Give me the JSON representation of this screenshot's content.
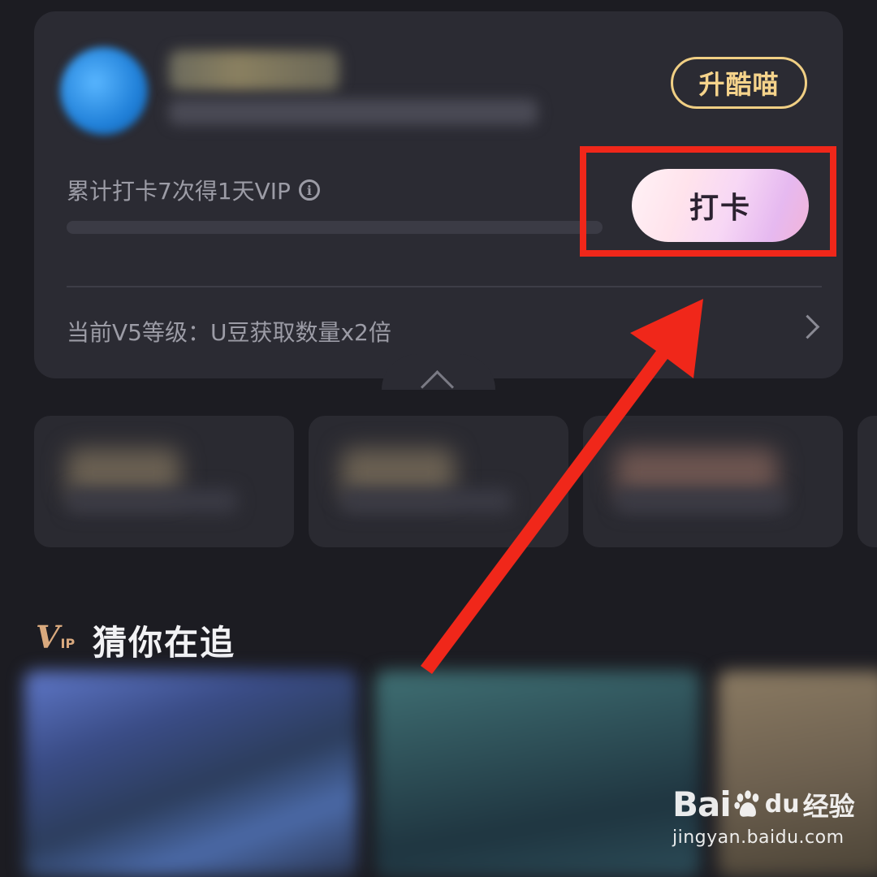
{
  "member_card": {
    "upgrade_label": "升酷喵",
    "checkin_info": "累计打卡7次得1天VIP",
    "info_icon": "info-icon",
    "checkin_progress": 0,
    "checkin_label": "打卡",
    "level_text": "当前V5等级：U豆获取数量x2倍",
    "chevron_icon": "chevron-right-icon"
  },
  "section": {
    "vip_badge_v": "V",
    "vip_badge_ip": "IP",
    "title": "猜你在追"
  },
  "watermark": {
    "brand": "Bai",
    "brand_du": "du",
    "product": "经验",
    "url": "jingyan.baidu.com"
  },
  "colors": {
    "background": "#1c1c22",
    "card": "#2b2b33",
    "upgrade_gold": "#f0cf84",
    "annotation_red": "#f0271a"
  }
}
